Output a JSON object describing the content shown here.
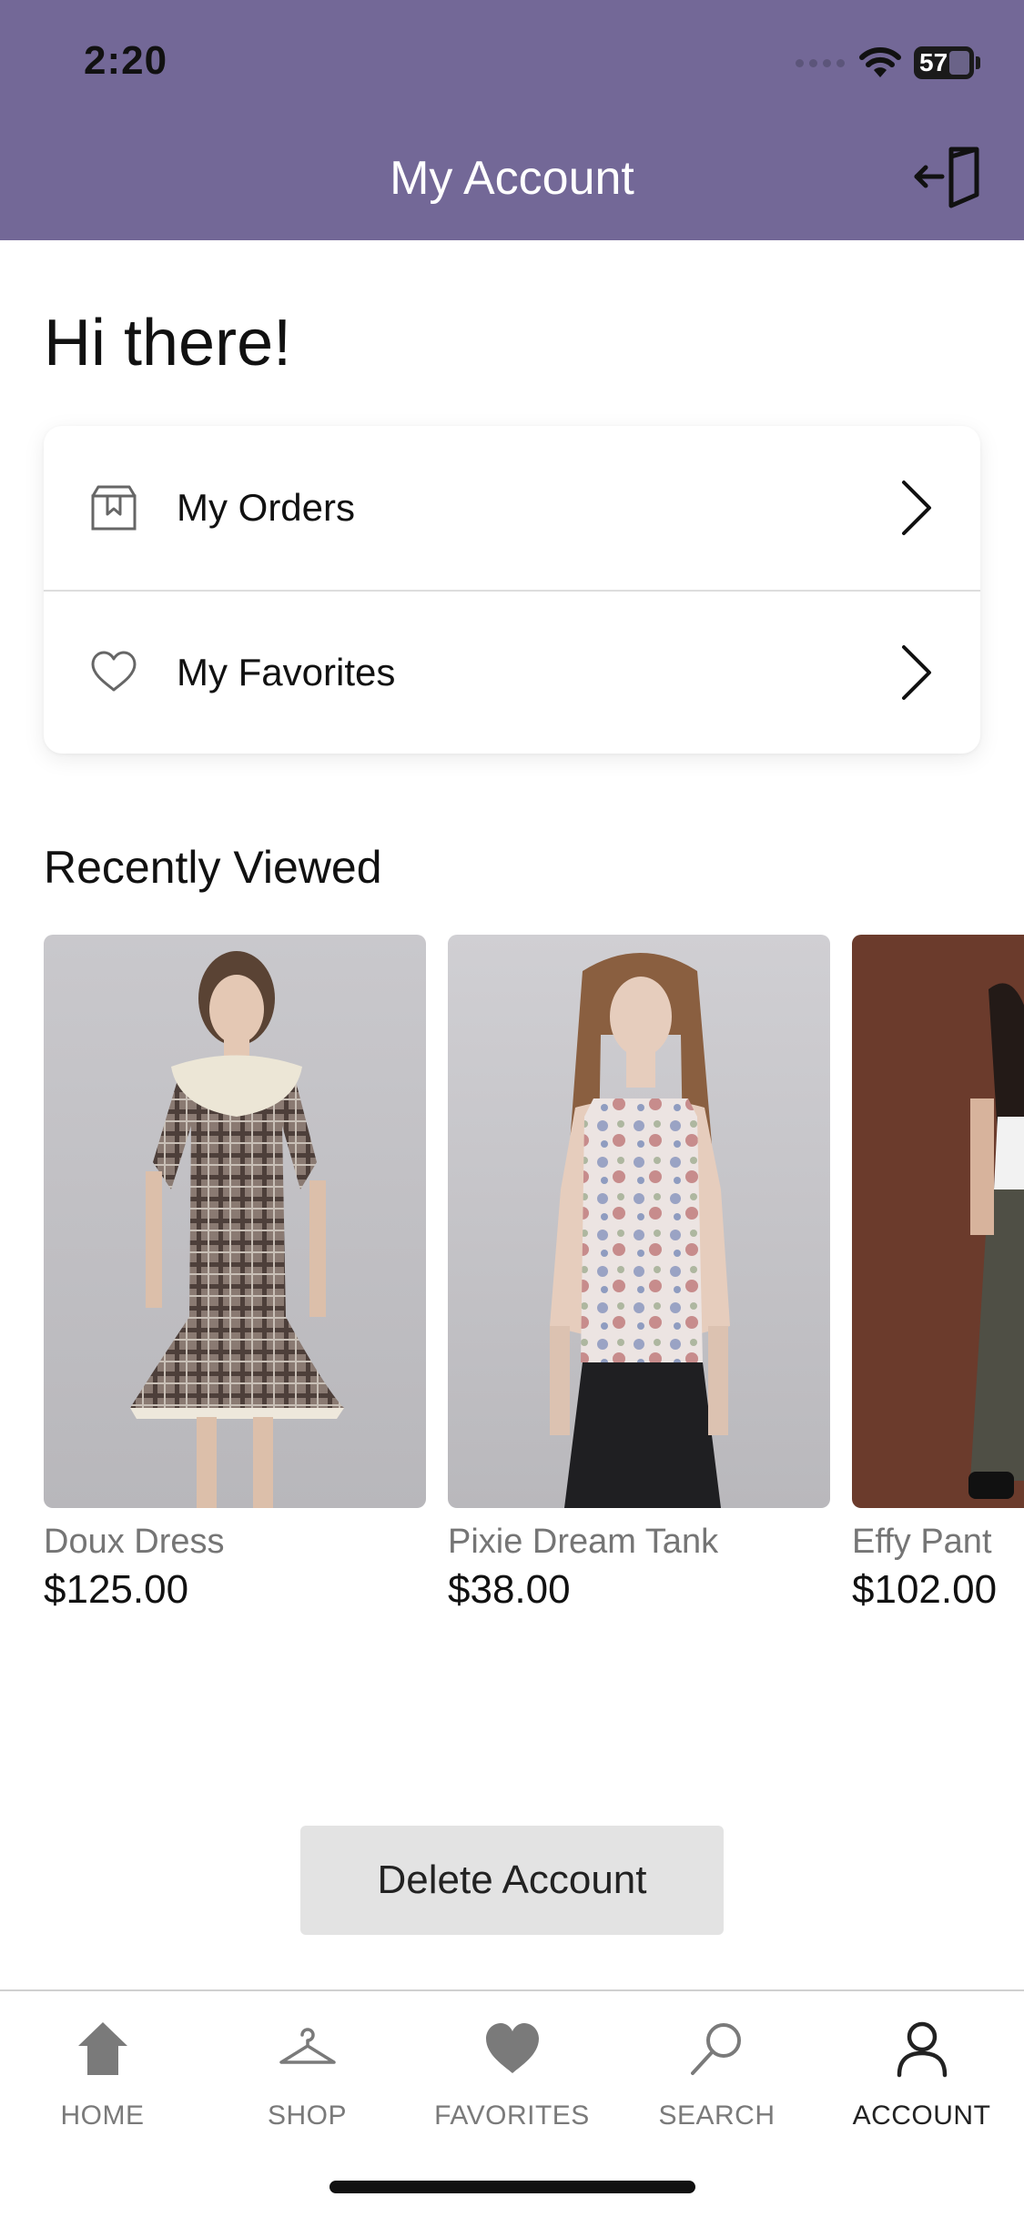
{
  "status_bar": {
    "time": "2:20",
    "battery": "57"
  },
  "header": {
    "title": "My Account",
    "logout_icon": "logout-icon"
  },
  "greeting": "Hi there!",
  "menu": [
    {
      "label": "My Orders",
      "icon": "orders-icon"
    },
    {
      "label": "My Favorites",
      "icon": "heart-outline-icon"
    }
  ],
  "recently_viewed": {
    "title": "Recently Viewed",
    "products": [
      {
        "name": "Doux Dress",
        "price": "$125.00"
      },
      {
        "name": "Pixie Dream Tank",
        "price": "$38.00"
      },
      {
        "name": "Effy Pant",
        "price": "$102.00"
      }
    ]
  },
  "delete_account_label": "Delete Account",
  "tabbar": {
    "items": [
      {
        "label": "HOME",
        "icon": "home-icon",
        "active": false
      },
      {
        "label": "SHOP",
        "icon": "hanger-icon",
        "active": false
      },
      {
        "label": "FAVORITES",
        "icon": "heart-icon",
        "active": false
      },
      {
        "label": "SEARCH",
        "icon": "search-icon",
        "active": false
      },
      {
        "label": "ACCOUNT",
        "icon": "account-icon",
        "active": true
      }
    ]
  },
  "colors": {
    "header_bg": "#736897",
    "delete_bg": "#e3e3e3",
    "inactive_tab": "#7a7a7a"
  }
}
